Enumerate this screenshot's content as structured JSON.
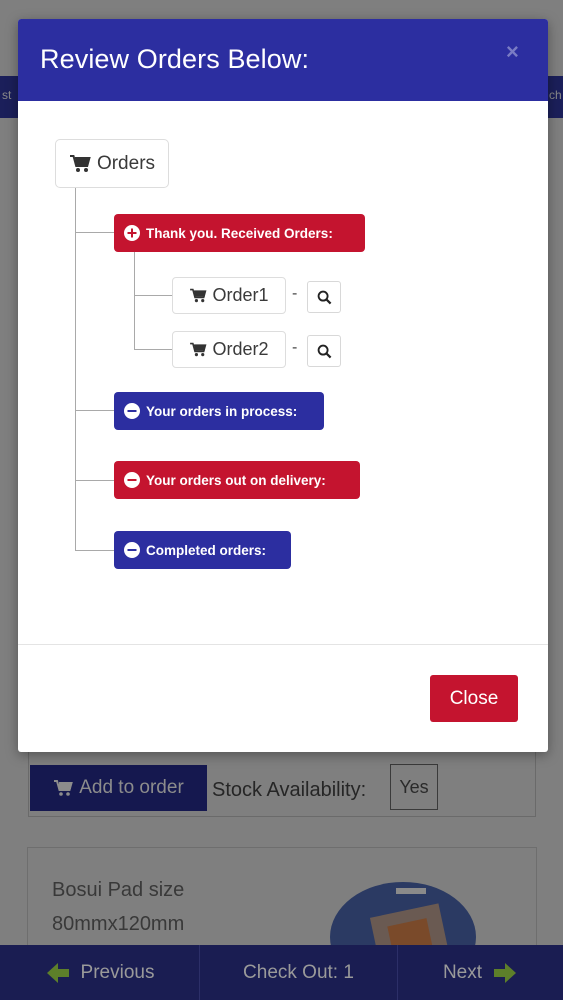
{
  "modal": {
    "title": "Review Orders Below:",
    "close_x": "×",
    "close_label": "Close"
  },
  "tree": {
    "root_label": "Orders",
    "statuses": [
      {
        "label": "Thank you. Received Orders:",
        "state": "expanded",
        "color": "#c4142f"
      },
      {
        "label": "Your orders in process:",
        "state": "collapsed",
        "color": "#2c2ea0"
      },
      {
        "label": "Your orders out on delivery:",
        "state": "collapsed",
        "color": "#c4142f"
      },
      {
        "label": "Completed orders:",
        "state": "collapsed",
        "color": "#2c2ea0"
      }
    ],
    "received_orders": [
      {
        "label": "Order1",
        "separator": "-"
      },
      {
        "label": "Order2",
        "separator": "-"
      }
    ]
  },
  "background": {
    "add_to_order": "Add to order",
    "stock_label": "Stock Availability:",
    "stock_value": "Yes",
    "product_name_line1": "Bosui Pad size",
    "product_name_line2": "80mmx120mm",
    "strip_left": "st",
    "strip_right": "ch"
  },
  "bottom_nav": {
    "previous": "Previous",
    "checkout": "Check Out: 1",
    "next": "Next"
  },
  "colors": {
    "primary_blue": "#2c2ea0",
    "danger_red": "#c4142f",
    "nav_dark": "#1a1d52"
  },
  "icons": {
    "cart": "cart-icon",
    "plus_circle": "plus-circle-icon",
    "minus_circle": "minus-circle-icon",
    "search": "search-icon",
    "arrow_left": "arrow-left-icon",
    "arrow_right": "arrow-right-icon"
  }
}
